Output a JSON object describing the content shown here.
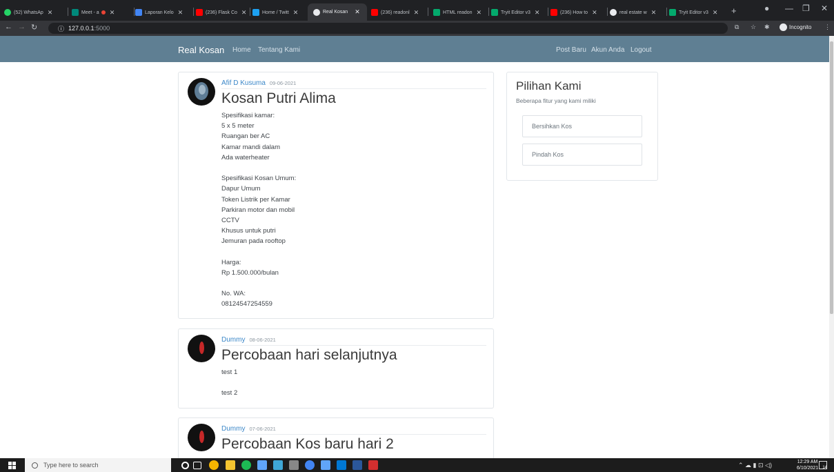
{
  "browser": {
    "tabs": [
      {
        "label": "(52) WhatsAp",
        "color": "#25d366"
      },
      {
        "label": "Meet - a",
        "color": "#00897b"
      },
      {
        "label": "Laporan Kelo",
        "color": "#4285f4"
      },
      {
        "label": "(236) Flask Co",
        "color": "#ff0000"
      },
      {
        "label": "Home / Twitt",
        "color": "#1da1f2"
      },
      {
        "label": "Real Kosan",
        "color": "#e8eaed"
      },
      {
        "label": "(236) readonl",
        "color": "#ff0000"
      },
      {
        "label": "HTML readon",
        "color": "#04aa6d"
      },
      {
        "label": "Tryit Editor v3",
        "color": "#04aa6d"
      },
      {
        "label": "(236) How to",
        "color": "#ff0000"
      },
      {
        "label": "real estate w",
        "color": "#e8eaed"
      },
      {
        "label": "Tryit Editor v3",
        "color": "#04aa6d"
      }
    ],
    "url_host": "127.0.0.1",
    "url_port": ":5000",
    "incognito_label": "Incognito"
  },
  "site": {
    "brand": "Real Kosan",
    "nav_left": [
      "Home",
      "Tentang Kami"
    ],
    "nav_right": [
      "Post Baru",
      "Akun Anda",
      "Logout"
    ]
  },
  "posts": [
    {
      "author": "Afif D Kusuma",
      "date": "09-06-2021",
      "title": "Kosan Putri Alima",
      "lines": [
        "Spesifikasi kamar:",
        "5 x 5 meter",
        "Ruangan ber AC",
        "Kamar mandi dalam",
        "Ada waterheater",
        "",
        "Spesifikasi Kosan Umum:",
        "Dapur Umum",
        "Token Listrik per Kamar",
        "Parkiran motor dan mobil",
        "CCTV",
        "Khusus untuk putri",
        "Jemuran pada rooftop",
        "",
        "Harga:",
        "Rp 1.500.000/bulan",
        "",
        "No. WA:",
        "08124547254559"
      ]
    },
    {
      "author": "Dummy",
      "date": "08-06-2021",
      "title": "Percobaan hari selanjutnya",
      "lines": [
        "test 1",
        "",
        "test 2"
      ]
    },
    {
      "author": "Dummy",
      "date": "07-06-2021",
      "title": "Percobaan Kos baru hari 2",
      "lines": []
    }
  ],
  "sidebar": {
    "title": "Pilihan Kami",
    "subtitle": "Beberapa fitur yang kami miliki",
    "buttons": [
      "Bersihkan Kos",
      "Pindah Kos"
    ]
  },
  "taskbar": {
    "search_placeholder": "Type here to search",
    "time": "12:29 AM",
    "date": "6/10/2021",
    "notification_count": "14"
  }
}
